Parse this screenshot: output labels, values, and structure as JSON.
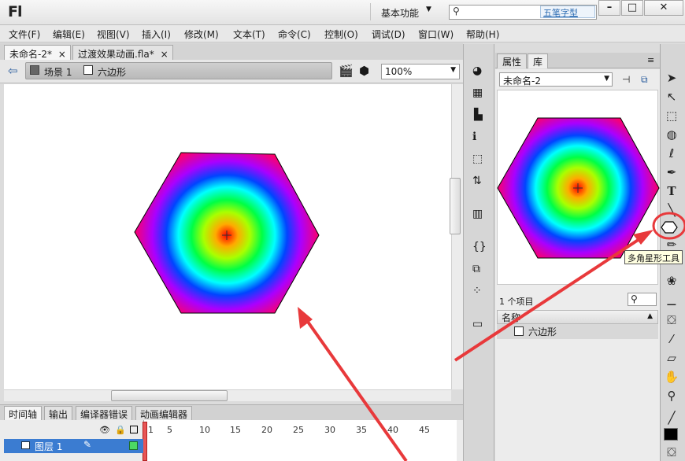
{
  "titlebar": {
    "logo": "Fl",
    "workspace": "基本功能",
    "ime": "五笔字型"
  },
  "menu": [
    "文件(F)",
    "编辑(E)",
    "视图(V)",
    "插入(I)",
    "修改(M)",
    "文本(T)",
    "命令(C)",
    "控制(O)",
    "调试(D)",
    "窗口(W)",
    "帮助(H)"
  ],
  "doc_tabs": [
    {
      "label": "未命名-2*",
      "close": "×"
    },
    {
      "label": "过渡效果动画.fla*",
      "close": "×"
    }
  ],
  "editbar": {
    "scene": "场景 1",
    "symbol": "六边形",
    "zoom": "100%"
  },
  "timeline": {
    "tabs": [
      "时间轴",
      "输出",
      "编译器错误",
      "动画编辑器"
    ],
    "layer": "图层 1",
    "frame_numbers": [
      "1",
      "5",
      "10",
      "15",
      "20",
      "25",
      "30",
      "35",
      "40",
      "45"
    ]
  },
  "panel": {
    "tabs": [
      "属性",
      "库"
    ],
    "doc": "未命名-2",
    "count": "1 个项目",
    "column_name": "名称",
    "item": "六边形"
  },
  "tools": {
    "tooltip": "多角星形工具"
  },
  "colors": {
    "selected_layer": "#3b7cd1",
    "annotation_arrow": "#e8393b",
    "hexagon_stroke": "#000000"
  }
}
